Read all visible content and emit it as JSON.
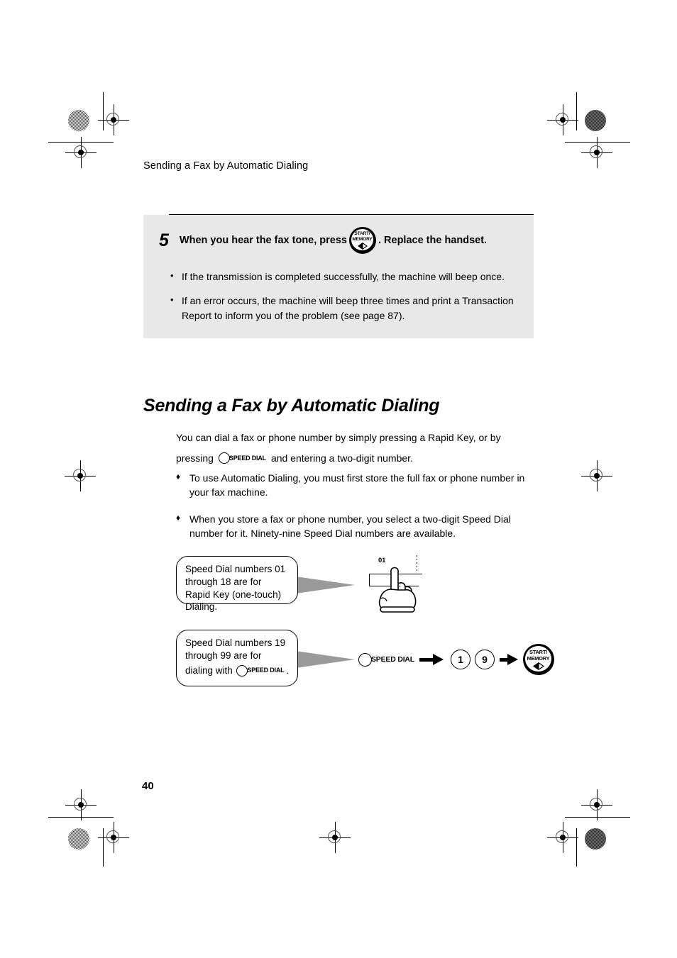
{
  "page": {
    "running_header": "Sending a Fax by Automatic Dialing",
    "page_number": "40"
  },
  "step_block": {
    "number": "5",
    "title_before_key": "When you hear the fax tone, press",
    "key_icon": "start-memory-key",
    "title_after_key": ". Replace the handset.",
    "bullets": [
      {
        "marker": "•",
        "text": "If the transmission is completed successfully, the machine will beep once."
      },
      {
        "marker": "•",
        "text": "If an error occurs, the machine will beep three times and print a Transaction Report to inform you of the problem (see page 87)."
      }
    ]
  },
  "section": {
    "heading": "Sending a Fax by Automatic Dialing",
    "intro_line1": "You can dial a fax or phone number by simply pressing a Rapid Key, or by",
    "intro_line2_before": "pressing",
    "intro_line2_after": "and entering a two-digit number.",
    "diamond_bullets": [
      {
        "marker": "♦",
        "text": "To use Automatic Dialing, you must first store the full fax or phone number in your fax machine."
      },
      {
        "marker": "♦",
        "text": "When you store a fax or phone number, you select a two-digit Speed Dial number for it. Ninety-nine Speed Dial numbers are available."
      }
    ]
  },
  "callouts": [
    {
      "text": "Speed Dial numbers 01 through 18 are for Rapid Key (one-touch) Dialing."
    },
    {
      "line1": "Speed Dial numbers 19",
      "line2": "through 99 are for",
      "line3_before": "dialing with",
      "line3_after": "."
    }
  ],
  "rapid_key": {
    "label": "01"
  },
  "key_sequence": {
    "speed_dial_label": "SPEED DIAL",
    "digit1": "1",
    "digit2": "9",
    "final_key": "start-memory-key"
  },
  "keys": {
    "start_memory_line1": "START/",
    "start_memory_line2": "MEMORY",
    "speed_dial_label": "SPEED DIAL"
  },
  "colors": {
    "step_block_bg": "#e8e8e8",
    "gray_arrow": "#9a9a9a",
    "ink": "#000000",
    "paper": "#ffffff"
  }
}
